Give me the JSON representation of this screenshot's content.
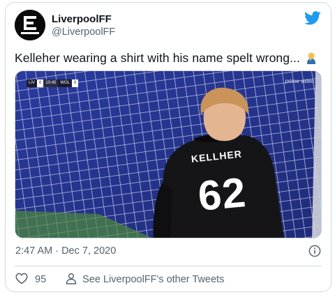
{
  "tweet": {
    "display_name": "LiverpoolFF",
    "handle": "@LiverpoolFF",
    "text": "Kelleher wearing a shirt with his name spelt wrong...",
    "emoji": "person-facepalming-emoji",
    "timestamp": "2:47 AM · Dec 7, 2020",
    "like_count": "95",
    "other_tweets_label": "See LiverpoolFF's other Tweets"
  },
  "media": {
    "scorebug": {
      "home": "LIV",
      "home_score": "0",
      "time": "10:45",
      "away": "WOL",
      "away_score": "0"
    },
    "watermark": "prime video",
    "shirt_name": "KELLHER",
    "shirt_number": "62"
  },
  "colors": {
    "twitter_blue": "#1d9bf0",
    "text_primary": "#0f1419",
    "text_secondary": "#536471",
    "border": "#cfd9de"
  },
  "icons": {
    "avatar": "liverpoolff-logo",
    "brand": "twitter-bird-icon",
    "info": "info-icon",
    "like": "heart-icon",
    "profile": "person-icon"
  }
}
